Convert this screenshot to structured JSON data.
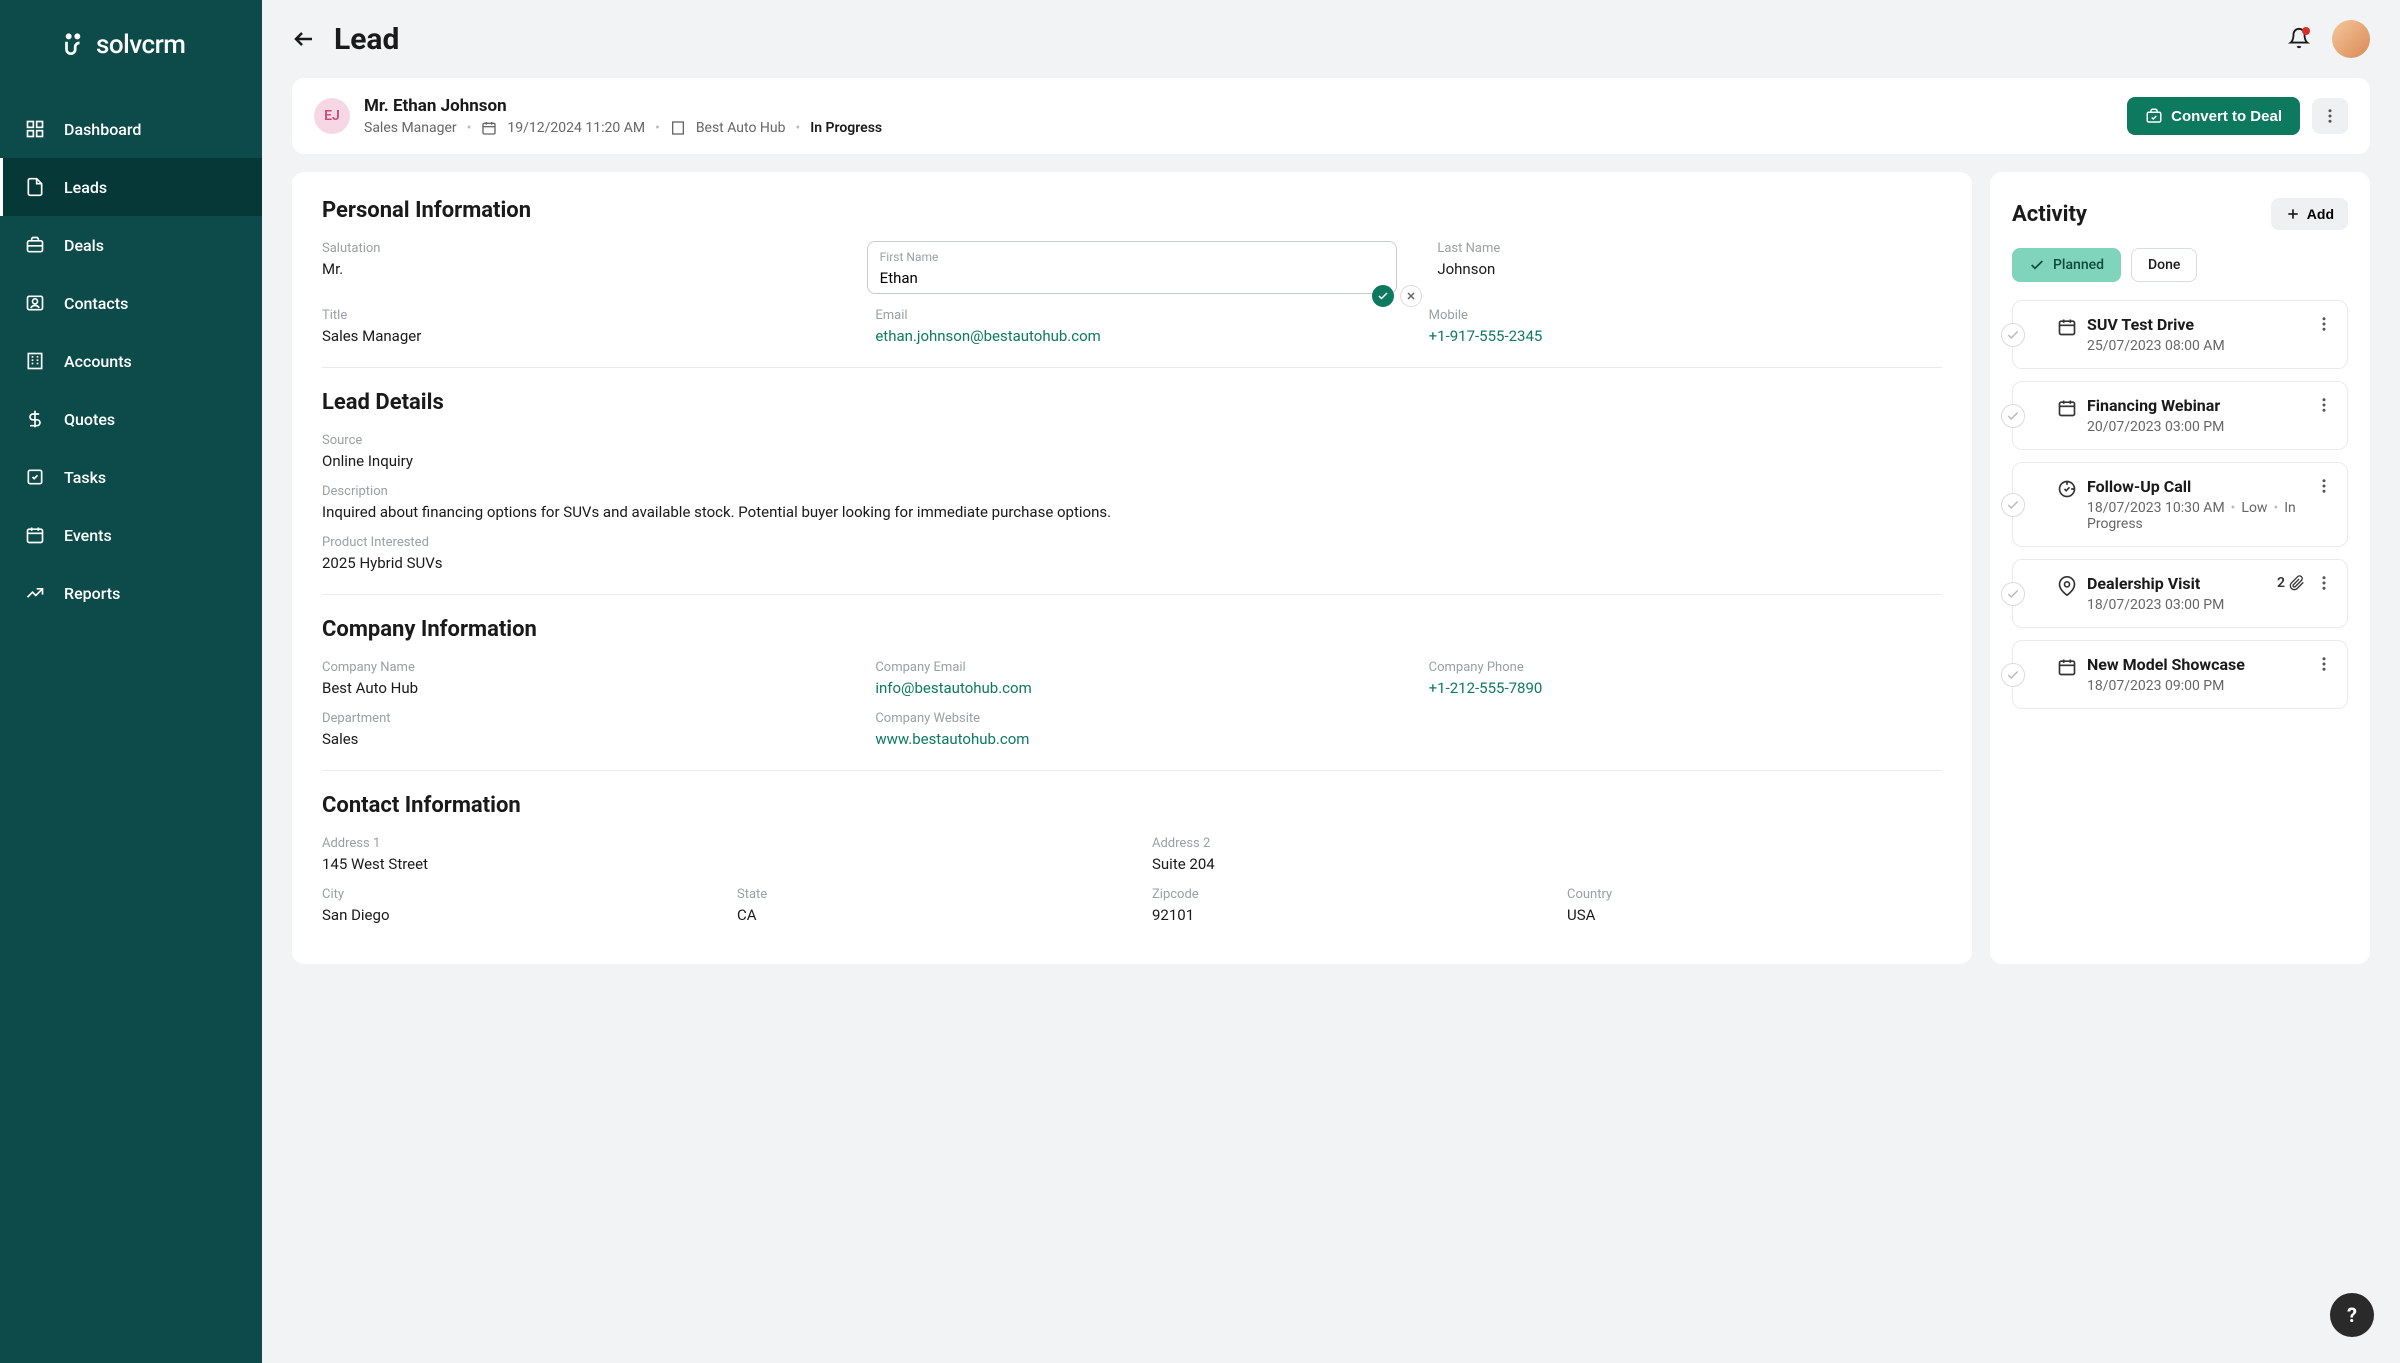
{
  "brand": {
    "name": "solvcrm"
  },
  "sidebar": {
    "items": [
      {
        "label": "Dashboard"
      },
      {
        "label": "Leads"
      },
      {
        "label": "Deals"
      },
      {
        "label": "Contacts"
      },
      {
        "label": "Accounts"
      },
      {
        "label": "Quotes"
      },
      {
        "label": "Tasks"
      },
      {
        "label": "Events"
      },
      {
        "label": "Reports"
      }
    ]
  },
  "page": {
    "title": "Lead"
  },
  "lead": {
    "initials": "EJ",
    "full_name": "Mr. Ethan Johnson",
    "role": "Sales Manager",
    "created": "19/12/2024 11:20 AM",
    "company": "Best Auto Hub",
    "status": "In Progress",
    "convert_label": "Convert to Deal"
  },
  "personal": {
    "heading": "Personal Information",
    "salutation": {
      "label": "Salutation",
      "value": "Mr."
    },
    "first_name": {
      "label": "First Name",
      "value": "Ethan"
    },
    "last_name": {
      "label": "Last Name",
      "value": "Johnson"
    },
    "title": {
      "label": "Title",
      "value": "Sales Manager"
    },
    "email": {
      "label": "Email",
      "value": "ethan.johnson@bestautohub.com"
    },
    "mobile": {
      "label": "Mobile",
      "value": "+1-917-555-2345"
    }
  },
  "lead_details": {
    "heading": "Lead Details",
    "source": {
      "label": "Source",
      "value": "Online Inquiry"
    },
    "description": {
      "label": "Description",
      "value": "Inquired about financing options for SUVs and available stock. Potential buyer looking for immediate purchase options."
    },
    "product": {
      "label": "Product Interested",
      "value": "2025 Hybrid SUVs"
    }
  },
  "company_info": {
    "heading": "Company Information",
    "name": {
      "label": "Company Name",
      "value": "Best Auto Hub"
    },
    "email": {
      "label": "Company Email",
      "value": "info@bestautohub.com"
    },
    "phone": {
      "label": "Company Phone",
      "value": "+1-212-555-7890"
    },
    "department": {
      "label": "Department",
      "value": "Sales"
    },
    "website": {
      "label": "Company Website",
      "value": "www.bestautohub.com"
    }
  },
  "contact_info": {
    "heading": "Contact Information",
    "address1": {
      "label": "Address 1",
      "value": "145 West Street"
    },
    "address2": {
      "label": "Address 2",
      "value": "Suite 204"
    },
    "city": {
      "label": "City",
      "value": "San Diego"
    },
    "state": {
      "label": "State",
      "value": "CA"
    },
    "zipcode": {
      "label": "Zipcode",
      "value": "92101"
    },
    "country": {
      "label": "Country",
      "value": "USA"
    }
  },
  "activity": {
    "heading": "Activity",
    "add_label": "Add",
    "tabs": {
      "planned": "Planned",
      "done": "Done"
    },
    "items": [
      {
        "title": "SUV Test Drive",
        "meta": "25/07/2023 08:00 AM"
      },
      {
        "title": "Financing Webinar",
        "meta": "20/07/2023 03:00 PM"
      },
      {
        "title": "Follow-Up Call",
        "meta_date": "18/07/2023 10:30 AM",
        "meta_prio": "Low",
        "meta_status": "In Progress"
      },
      {
        "title": "Dealership Visit",
        "meta": "18/07/2023 03:00 PM",
        "attach_count": "2"
      },
      {
        "title": "New Model Showcase",
        "meta": "18/07/2023 09:00 PM"
      }
    ]
  },
  "colors": {
    "primary": "#0d7a5f",
    "sidebar": "#0d4a4a"
  }
}
